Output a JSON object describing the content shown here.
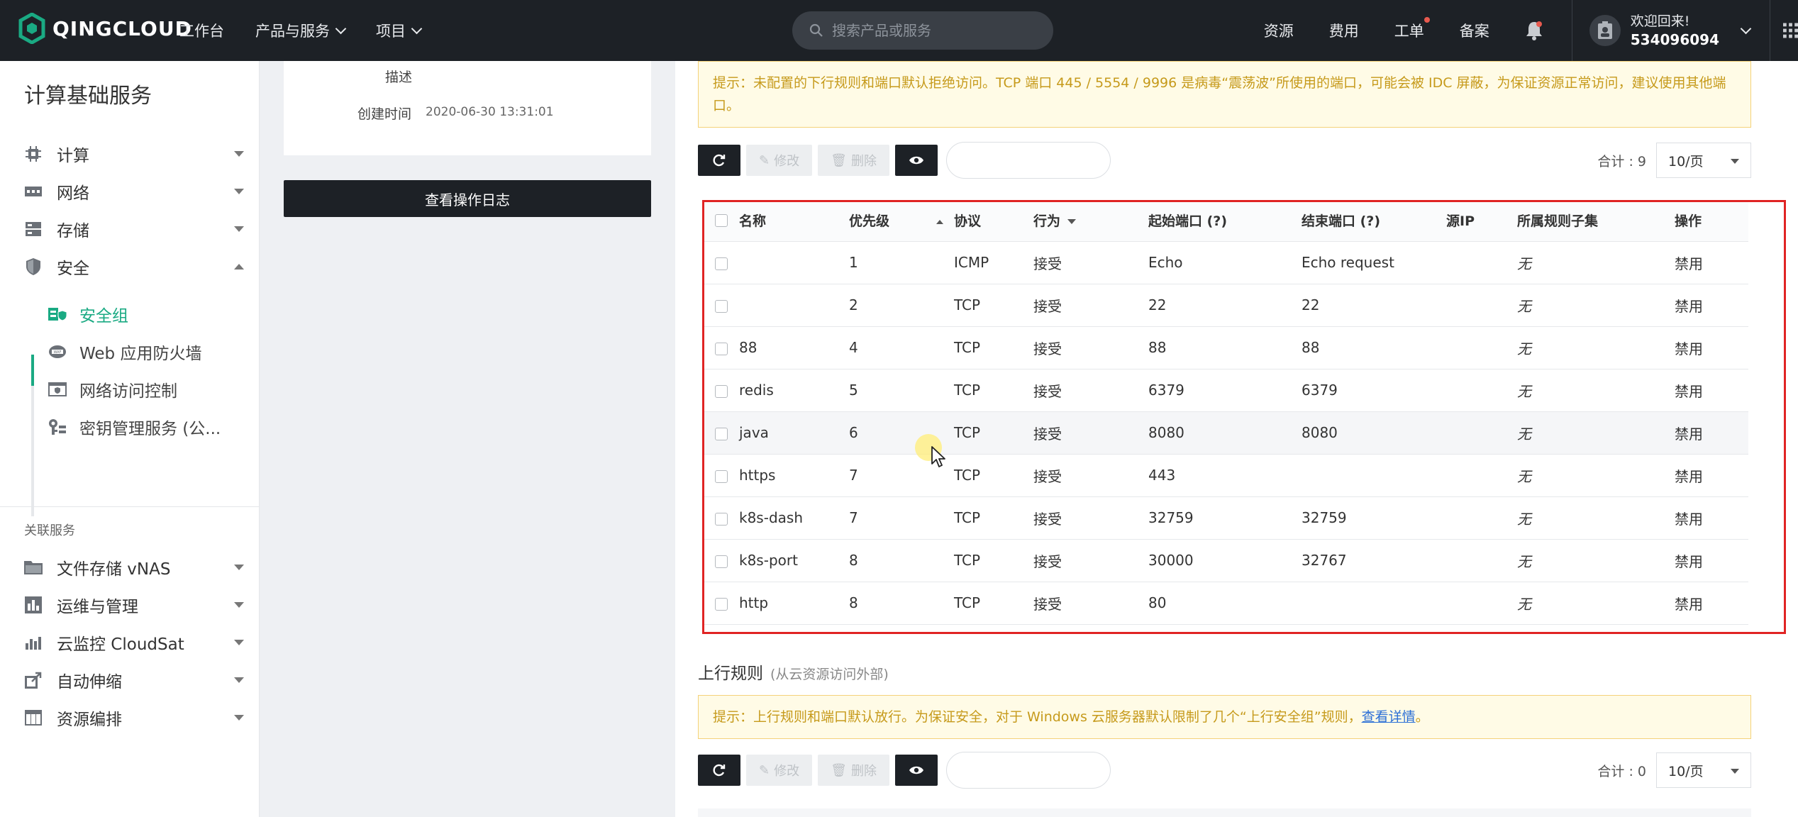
{
  "topbar": {
    "logo_text": "QINGCLOUD",
    "nav": [
      {
        "label": "工作台",
        "dropdown": false
      },
      {
        "label": "产品与服务",
        "dropdown": true
      },
      {
        "label": "项目",
        "dropdown": true
      }
    ],
    "search_placeholder": "搜索产品或服务",
    "right_links": [
      {
        "label": "资源",
        "badge": false
      },
      {
        "label": "费用",
        "badge": false
      },
      {
        "label": "工单",
        "badge": true
      },
      {
        "label": "备案",
        "badge": false
      }
    ],
    "welcome": "欢迎回来!",
    "user_id": "534096094"
  },
  "sidebar": {
    "title": "计算基础服务",
    "items": [
      {
        "label": "计算",
        "icon": "chip-icon",
        "expanded": false
      },
      {
        "label": "网络",
        "icon": "network-icon",
        "expanded": false
      },
      {
        "label": "存储",
        "icon": "storage-icon",
        "expanded": false
      },
      {
        "label": "安全",
        "icon": "shield-icon",
        "expanded": true
      }
    ],
    "security_subitems": [
      {
        "label": "安全组",
        "icon": "security-group-icon",
        "active": true
      },
      {
        "label": "Web 应用防火墙",
        "icon": "waf-icon",
        "active": false
      },
      {
        "label": "网络访问控制",
        "icon": "access-control-icon",
        "active": false
      },
      {
        "label": "密钥管理服务 (公...",
        "icon": "key-icon",
        "active": false
      }
    ],
    "related_title": "关联服务",
    "related_items": [
      {
        "label": "文件存储 vNAS",
        "icon": "folder-icon"
      },
      {
        "label": "运维与管理",
        "icon": "ops-icon"
      },
      {
        "label": "云监控 CloudSat",
        "icon": "monitor-icon"
      },
      {
        "label": "自动伸缩",
        "icon": "autoscale-icon"
      },
      {
        "label": "资源编排",
        "icon": "orchestration-icon"
      }
    ]
  },
  "detail": {
    "desc_label": "描述",
    "created_label": "创建时间",
    "created_value": "2020-06-30 13:31:01",
    "log_button": "查看操作日志"
  },
  "downlink": {
    "warning": "提示：未配置的下行规则和端口默认拒绝访问。TCP 端口 445 / 5554 / 9996 是病毒“震荡波”所使用的端口，可能会被 IDC 屏蔽，为保证资源正常访问，建议使用其他端口。",
    "toolbar": {
      "edit": "修改",
      "delete": "删除"
    },
    "total": "合计 : 9",
    "page_size": "10/页",
    "columns": [
      "名称",
      "优先级",
      "协议",
      "行为",
      "起始端口 (?)",
      "结束端口 (?)",
      "源IP",
      "所属规则子集",
      "操作"
    ],
    "rows": [
      {
        "name": "",
        "priority": "1",
        "protocol": "ICMP",
        "action": "接受",
        "start": "Echo",
        "end": "Echo request",
        "src": "",
        "subset": "无",
        "op": "禁用"
      },
      {
        "name": "",
        "priority": "2",
        "protocol": "TCP",
        "action": "接受",
        "start": "22",
        "end": "22",
        "src": "",
        "subset": "无",
        "op": "禁用"
      },
      {
        "name": "88",
        "priority": "4",
        "protocol": "TCP",
        "action": "接受",
        "start": "88",
        "end": "88",
        "src": "",
        "subset": "无",
        "op": "禁用"
      },
      {
        "name": "redis",
        "priority": "5",
        "protocol": "TCP",
        "action": "接受",
        "start": "6379",
        "end": "6379",
        "src": "",
        "subset": "无",
        "op": "禁用"
      },
      {
        "name": "java",
        "priority": "6",
        "protocol": "TCP",
        "action": "接受",
        "start": "8080",
        "end": "8080",
        "src": "",
        "subset": "无",
        "op": "禁用"
      },
      {
        "name": "https",
        "priority": "7",
        "protocol": "TCP",
        "action": "接受",
        "start": "443",
        "end": "",
        "src": "",
        "subset": "无",
        "op": "禁用"
      },
      {
        "name": "k8s-dash",
        "priority": "7",
        "protocol": "TCP",
        "action": "接受",
        "start": "32759",
        "end": "32759",
        "src": "",
        "subset": "无",
        "op": "禁用"
      },
      {
        "name": "k8s-port",
        "priority": "8",
        "protocol": "TCP",
        "action": "接受",
        "start": "30000",
        "end": "32767",
        "src": "",
        "subset": "无",
        "op": "禁用"
      },
      {
        "name": "http",
        "priority": "8",
        "protocol": "TCP",
        "action": "接受",
        "start": "80",
        "end": "",
        "src": "",
        "subset": "无",
        "op": "禁用"
      }
    ]
  },
  "uplink": {
    "title": "上行规则",
    "subtitle": "(从云资源访问外部)",
    "warning": "提示：上行规则和端口默认放行。为保证安全，对于 Windows 云服务器默认限制了几个“上行安全组”规则，",
    "warning_link": "查看详情",
    "warning_end": "。",
    "toolbar": {
      "edit": "修改",
      "delete": "删除"
    },
    "total": "合计 : 0",
    "page_size": "10/页"
  },
  "colors": {
    "topbar": "#1d2126",
    "accent": "#1aaa83",
    "link": "#2b6fd6",
    "highlight": "#e02424",
    "warning_text": "#c69a1b"
  }
}
